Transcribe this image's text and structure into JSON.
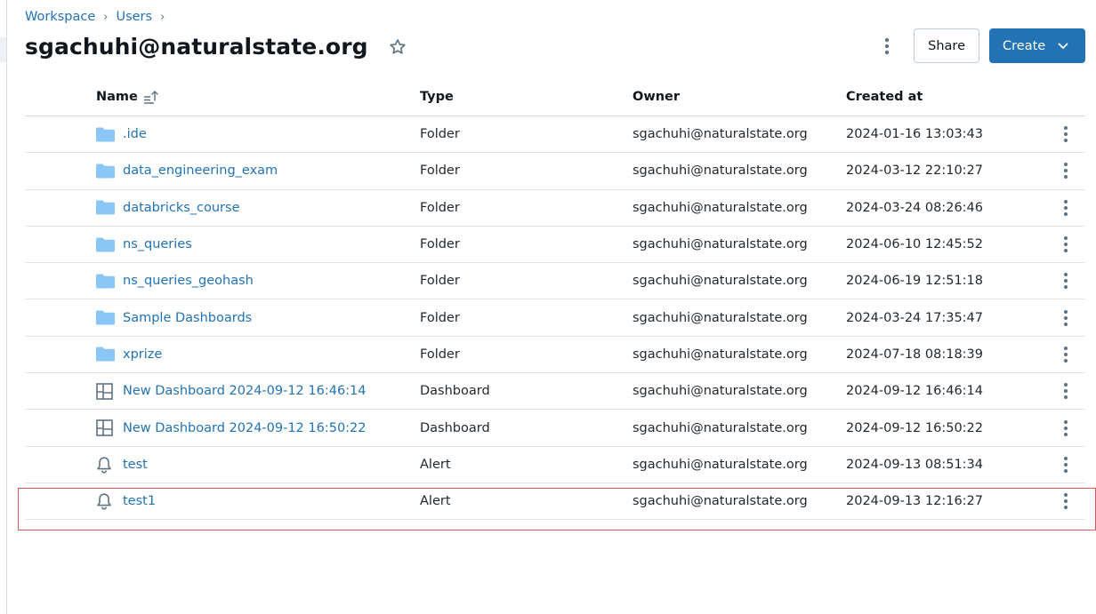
{
  "breadcrumb": [
    {
      "label": "Workspace"
    },
    {
      "label": "Users"
    }
  ],
  "breadcrumb_separator": "›",
  "page": {
    "title": "sgachuhi@naturalstate.org",
    "favorite_icon": "star-outline-icon"
  },
  "header_actions": {
    "more_icon": "kebab-vertical-icon",
    "share_label": "Share",
    "create_label": "Create",
    "create_icon": "chevron-down-icon"
  },
  "table": {
    "columns": {
      "name": "Name",
      "type": "Type",
      "owner": "Owner",
      "created": "Created at"
    },
    "sort": {
      "column": "name",
      "direction": "ascending",
      "icon": "sort-ascending-icon"
    },
    "rows": [
      {
        "name": ".ide",
        "type": "Folder",
        "owner": "sgachuhi@naturalstate.org",
        "created": "2024-01-16 13:03:43",
        "icon": "folder"
      },
      {
        "name": "data_engineering_exam",
        "type": "Folder",
        "owner": "sgachuhi@naturalstate.org",
        "created": "2024-03-12 22:10:27",
        "icon": "folder"
      },
      {
        "name": "databricks_course",
        "type": "Folder",
        "owner": "sgachuhi@naturalstate.org",
        "created": "2024-03-24 08:26:46",
        "icon": "folder"
      },
      {
        "name": "ns_queries",
        "type": "Folder",
        "owner": "sgachuhi@naturalstate.org",
        "created": "2024-06-10 12:45:52",
        "icon": "folder"
      },
      {
        "name": "ns_queries_geohash",
        "type": "Folder",
        "owner": "sgachuhi@naturalstate.org",
        "created": "2024-06-19 12:51:18",
        "icon": "folder"
      },
      {
        "name": "Sample Dashboards",
        "type": "Folder",
        "owner": "sgachuhi@naturalstate.org",
        "created": "2024-03-24 17:35:47",
        "icon": "folder"
      },
      {
        "name": "xprize",
        "type": "Folder",
        "owner": "sgachuhi@naturalstate.org",
        "created": "2024-07-18 08:18:39",
        "icon": "folder"
      },
      {
        "name": "New Dashboard 2024-09-12 16:46:14",
        "type": "Dashboard",
        "owner": "sgachuhi@naturalstate.org",
        "created": "2024-09-12 16:46:14",
        "icon": "dashboard"
      },
      {
        "name": "New Dashboard 2024-09-12 16:50:22",
        "type": "Dashboard",
        "owner": "sgachuhi@naturalstate.org",
        "created": "2024-09-12 16:50:22",
        "icon": "dashboard"
      },
      {
        "name": "test",
        "type": "Alert",
        "owner": "sgachuhi@naturalstate.org",
        "created": "2024-09-13 08:51:34",
        "icon": "alert"
      },
      {
        "name": "test1",
        "type": "Alert",
        "owner": "sgachuhi@naturalstate.org",
        "created": "2024-09-13 12:16:27",
        "icon": "alert",
        "highlighted": true
      }
    ]
  },
  "colors": {
    "link": "#2272b4",
    "primary_button": "#2272b4",
    "folder_icon": "#8ac7f6",
    "highlight_border": "#e05757"
  }
}
